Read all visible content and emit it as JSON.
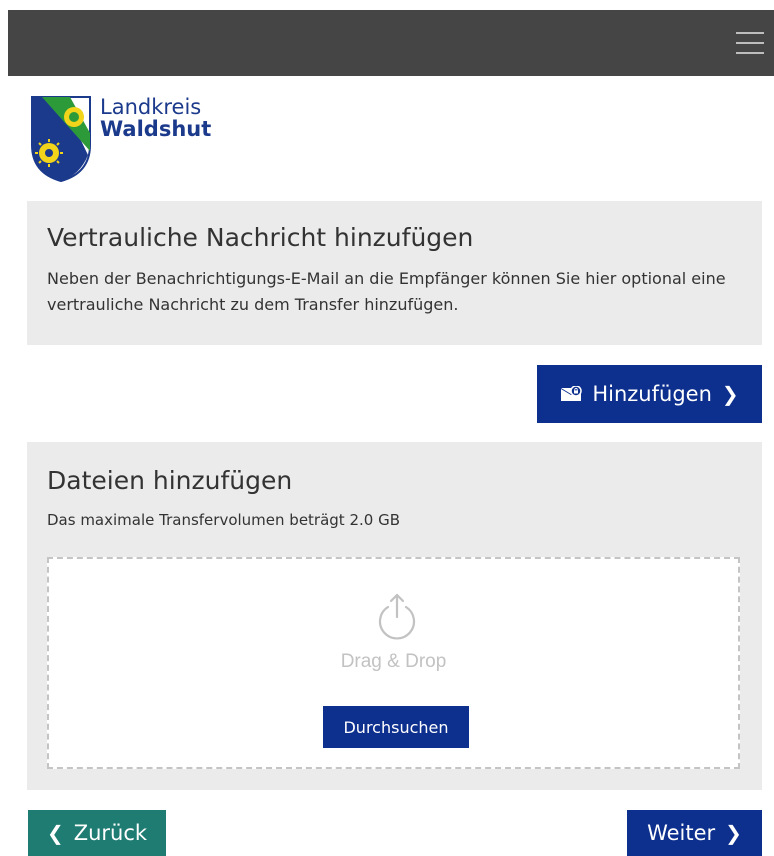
{
  "header": {
    "menu_icon": "hamburger-menu-icon",
    "background_color": "#454545"
  },
  "logo": {
    "line1": "Landkreis",
    "line2": "Waldshut",
    "color": "#1b3a8c"
  },
  "message_section": {
    "title": "Vertrauliche Nachricht hinzufügen",
    "description": "Neben der Benachrichtigungs-E-Mail an die Empfänger können Sie hier optional eine vertrauliche Nachricht zu dem Transfer hinzufügen.",
    "add_button_label": "Hinzufügen",
    "add_button_icon": "secure-envelope-icon"
  },
  "files_section": {
    "title": "Dateien hinzufügen",
    "description": "Das maximale Transfervolumen beträgt 2.0 GB",
    "dropzone_icon": "upload-icon",
    "dropzone_text": "Drag & Drop",
    "browse_button_label": "Durchsuchen"
  },
  "navigation": {
    "back_label": "Zurück",
    "next_label": "Weiter"
  },
  "colors": {
    "primary_blue": "#0d2f8e",
    "back_teal": "#1e7c72",
    "panel_gray": "#ebebeb"
  }
}
